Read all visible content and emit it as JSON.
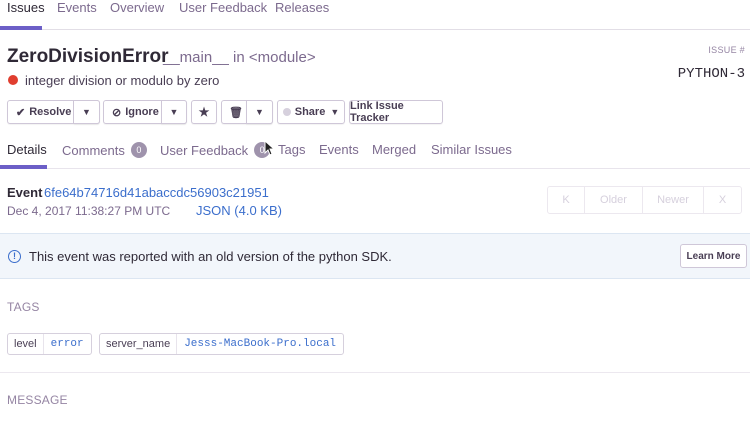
{
  "nav": {
    "items": [
      "Issues",
      "Events",
      "Overview",
      "User Feedback",
      "Releases"
    ]
  },
  "issue": {
    "title": "ZeroDivisionError",
    "culprit": "__main__ in <module>",
    "message": "integer division or modulo by zero",
    "level_color": "#e03e2f",
    "id_label": "ISSUE #",
    "short_id": "PYTHON-3"
  },
  "actions": {
    "resolve": "Resolve",
    "ignore": "Ignore",
    "share": "Share",
    "link_tracker": "Link Issue Tracker"
  },
  "tabs": {
    "details": "Details",
    "comments": "Comments",
    "comments_count": "0",
    "user_feedback": "User Feedback",
    "user_feedback_count": "0",
    "tags": "Tags",
    "events": "Events",
    "merged": "Merged",
    "similar": "Similar Issues"
  },
  "event": {
    "label": "Event",
    "id": "6fe64b74716d41abaccdc56903c21951",
    "date": "Dec 4, 2017 11:38:27 PM UTC",
    "json": "JSON (4.0 KB)"
  },
  "pager": {
    "oldest": "K",
    "older": "Older",
    "newer": "Newer",
    "newest": "X"
  },
  "alert": {
    "icon": "!",
    "text": "This event was reported with an old version of the python SDK.",
    "button": "Learn More"
  },
  "tags_section": {
    "title": "TAGS",
    "items": [
      {
        "key": "level",
        "value": "error"
      },
      {
        "key": "server_name",
        "value": "Jesss-MacBook-Pro.local"
      }
    ]
  },
  "message_section": {
    "title": "MESSAGE"
  },
  "colors": {
    "accent": "#6c5fc7",
    "link": "#3b6ecc",
    "error": "#e03e2f"
  }
}
